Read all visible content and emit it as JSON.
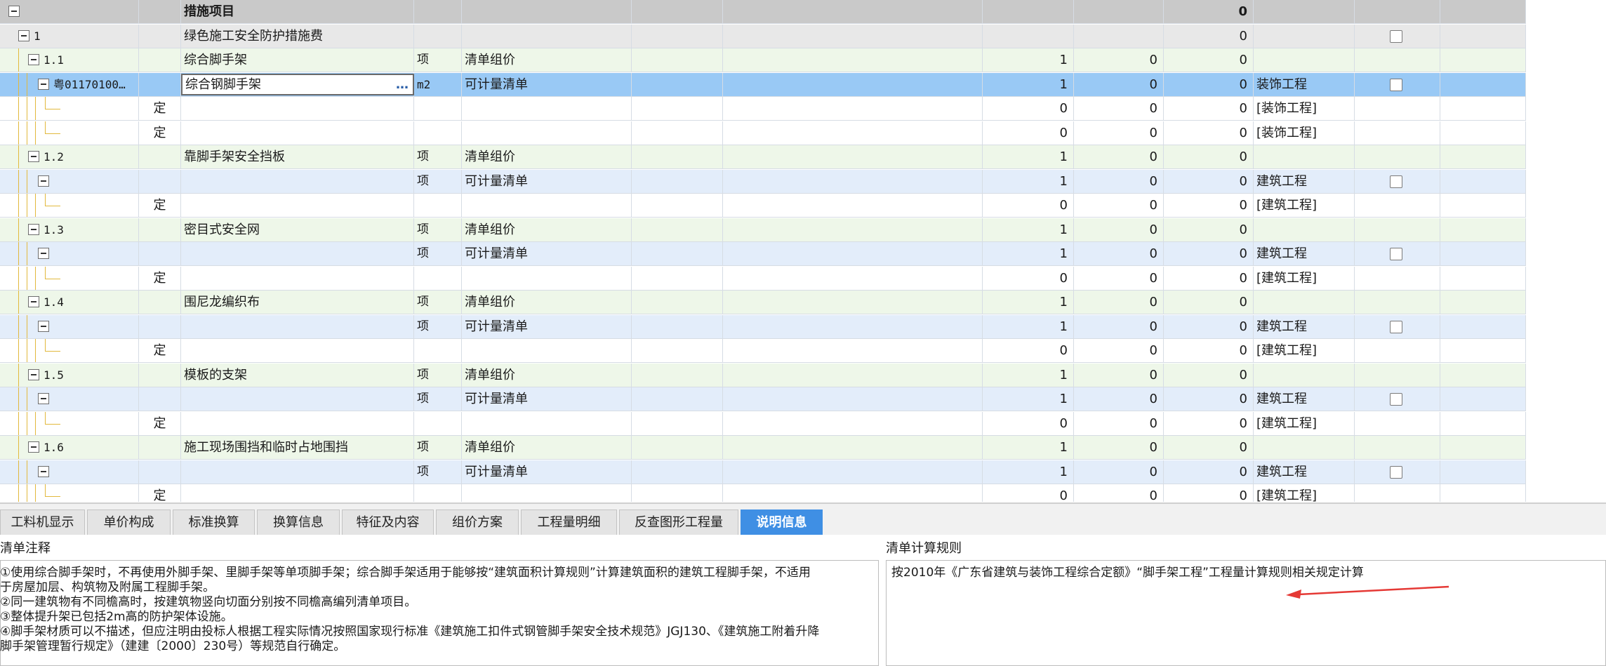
{
  "grid": {
    "rows": [
      {
        "kind": "header",
        "tree_label": "",
        "name": "措施项目",
        "unit": "",
        "e": "",
        "desc": "",
        "qty": "",
        "p1": "",
        "p2": "0",
        "prof": "",
        "check": false
      },
      {
        "kind": "level1",
        "tree_label": "1",
        "name": "绿色施工安全防护措施费",
        "unit": "",
        "e": "",
        "desc": "",
        "qty": "",
        "p1": "",
        "p2": "0",
        "prof": "",
        "check": true
      },
      {
        "kind": "group",
        "tree_label": "1.1",
        "name": "综合脚手架",
        "unit": "项",
        "e": "清单组价",
        "desc": "",
        "qty": "1",
        "p1": "0",
        "p2": "0",
        "prof": "",
        "check": false
      },
      {
        "kind": "selected",
        "tree_label": "粤01170100…",
        "name": "综合钢脚手架",
        "unit": "m2",
        "e": "可计量清单",
        "desc": "",
        "qty": "1",
        "p1": "0",
        "p2": "0",
        "prof": "装饰工程",
        "check": true,
        "name_ellipsis": "…"
      },
      {
        "kind": "quota",
        "type": "定",
        "name": "",
        "unit": "",
        "e": "",
        "desc": "",
        "qty": "0",
        "p1": "0",
        "p2": "0",
        "prof": "[装饰工程]",
        "check": false
      },
      {
        "kind": "quota",
        "type": "定",
        "name": "",
        "unit": "",
        "e": "",
        "desc": "",
        "qty": "0",
        "p1": "0",
        "p2": "0",
        "prof": "[装饰工程]",
        "check": false
      },
      {
        "kind": "group",
        "tree_label": "1.2",
        "name": "靠脚手架安全挡板",
        "unit": "项",
        "e": "清单组价",
        "desc": "",
        "qty": "1",
        "p1": "0",
        "p2": "0",
        "prof": "",
        "check": false
      },
      {
        "kind": "item",
        "tree_label": "",
        "name": "",
        "unit": "项",
        "e": "可计量清单",
        "desc": "",
        "qty": "1",
        "p1": "0",
        "p2": "0",
        "prof": "建筑工程",
        "check": true
      },
      {
        "kind": "quota",
        "type": "定",
        "name": "",
        "unit": "",
        "e": "",
        "desc": "",
        "qty": "0",
        "p1": "0",
        "p2": "0",
        "prof": "[建筑工程]",
        "check": false
      },
      {
        "kind": "group",
        "tree_label": "1.3",
        "name": "密目式安全网",
        "unit": "项",
        "e": "清单组价",
        "desc": "",
        "qty": "1",
        "p1": "0",
        "p2": "0",
        "prof": "",
        "check": false
      },
      {
        "kind": "item",
        "tree_label": "",
        "name": "",
        "unit": "项",
        "e": "可计量清单",
        "desc": "",
        "qty": "1",
        "p1": "0",
        "p2": "0",
        "prof": "建筑工程",
        "check": true
      },
      {
        "kind": "quota",
        "type": "定",
        "name": "",
        "unit": "",
        "e": "",
        "desc": "",
        "qty": "0",
        "p1": "0",
        "p2": "0",
        "prof": "[建筑工程]",
        "check": false
      },
      {
        "kind": "group",
        "tree_label": "1.4",
        "name": "围尼龙编织布",
        "unit": "项",
        "e": "清单组价",
        "desc": "",
        "qty": "1",
        "p1": "0",
        "p2": "0",
        "prof": "",
        "check": false
      },
      {
        "kind": "item",
        "tree_label": "",
        "name": "",
        "unit": "项",
        "e": "可计量清单",
        "desc": "",
        "qty": "1",
        "p1": "0",
        "p2": "0",
        "prof": "建筑工程",
        "check": true
      },
      {
        "kind": "quota",
        "type": "定",
        "name": "",
        "unit": "",
        "e": "",
        "desc": "",
        "qty": "0",
        "p1": "0",
        "p2": "0",
        "prof": "[建筑工程]",
        "check": false
      },
      {
        "kind": "group",
        "tree_label": "1.5",
        "name": "模板的支架",
        "unit": "项",
        "e": "清单组价",
        "desc": "",
        "qty": "1",
        "p1": "0",
        "p2": "0",
        "prof": "",
        "check": false
      },
      {
        "kind": "item",
        "tree_label": "",
        "name": "",
        "unit": "项",
        "e": "可计量清单",
        "desc": "",
        "qty": "1",
        "p1": "0",
        "p2": "0",
        "prof": "建筑工程",
        "check": true
      },
      {
        "kind": "quota",
        "type": "定",
        "name": "",
        "unit": "",
        "e": "",
        "desc": "",
        "qty": "0",
        "p1": "0",
        "p2": "0",
        "prof": "[建筑工程]",
        "check": false
      },
      {
        "kind": "group",
        "tree_label": "1.6",
        "name": "施工现场围挡和临时占地围挡",
        "unit": "项",
        "e": "清单组价",
        "desc": "",
        "qty": "1",
        "p1": "0",
        "p2": "0",
        "prof": "",
        "check": false
      },
      {
        "kind": "item",
        "tree_label": "",
        "name": "",
        "unit": "项",
        "e": "可计量清单",
        "desc": "",
        "qty": "1",
        "p1": "0",
        "p2": "0",
        "prof": "建筑工程",
        "check": true
      },
      {
        "kind": "quota",
        "type": "定",
        "name": "",
        "unit": "",
        "e": "",
        "desc": "",
        "qty": "0",
        "p1": "0",
        "p2": "0",
        "prof": "[建筑工程]",
        "check": false
      }
    ]
  },
  "tabs": [
    {
      "label": "工料机显示",
      "active": false
    },
    {
      "label": "单价构成",
      "active": false
    },
    {
      "label": "标准换算",
      "active": false
    },
    {
      "label": "换算信息",
      "active": false
    },
    {
      "label": "特征及内容",
      "active": false
    },
    {
      "label": "组价方案",
      "active": false
    },
    {
      "label": "工程量明细",
      "active": false
    },
    {
      "label": "反查图形工程量",
      "active": false
    },
    {
      "label": "说明信息",
      "active": true
    }
  ],
  "panel_left": {
    "title": "清单注释",
    "lines": [
      "①使用综合脚手架时，不再使用外脚手架、里脚手架等单项脚手架；综合脚手架适用于能够按“建筑面积计算规则”计算建筑面积的建筑工程脚手架，不适用",
      "于房屋加层、构筑物及附属工程脚手架。",
      "②同一建筑物有不同檐高时，按建筑物竖向切面分别按不同檐高编列清单项目。",
      "③整体提升架已包括2m高的防护架体设施。",
      "④脚手架材质可以不描述，但应注明由投标人根据工程实际情况按照国家现行标准《建筑施工扣件式钢管脚手架安全技术规范》JGJ130、《建筑施工附着升降",
      "脚手架管理暂行规定》（建建〔2000〕230号）等规范自行确定。"
    ]
  },
  "panel_right": {
    "title": "清单计算规则",
    "text": "按2010年《广东省建筑与装饰工程综合定额》“脚手架工程”工程量计算规则相关规定计算"
  },
  "colors": {
    "header_bg": "#c9c9c9",
    "group_bg": "#eef7e9",
    "item_bg": "#e3edfa",
    "selected_bg": "#99c9f5",
    "active_tab": "#3f8fe4",
    "arrow": "#e53935"
  },
  "icons": [
    "collapse-toggle-icon",
    "checkbox-icon",
    "ellipsis-icon",
    "red-arrow-icon"
  ]
}
